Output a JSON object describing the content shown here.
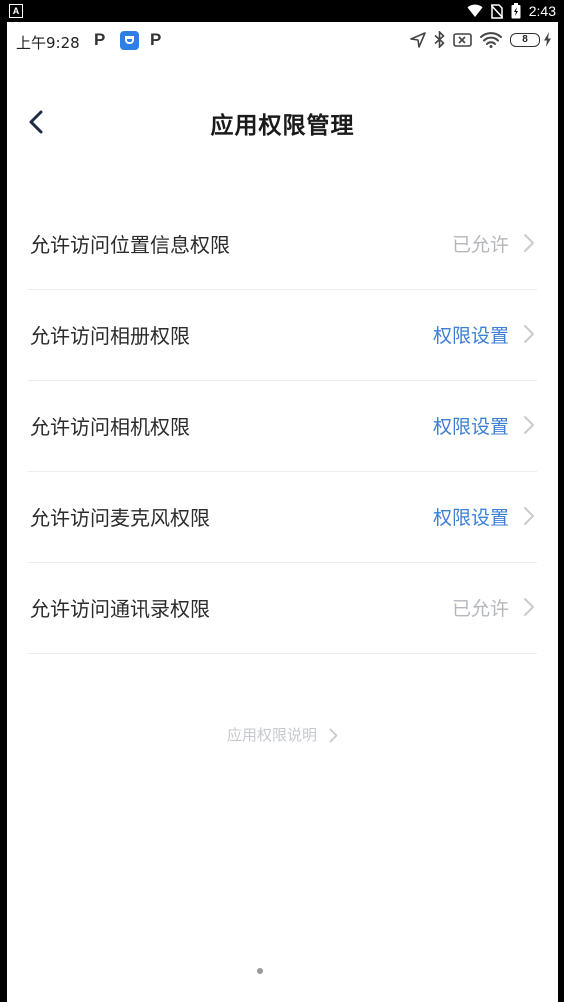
{
  "system_bar": {
    "notification_letter": "A",
    "time": "2:43"
  },
  "status_bar": {
    "time": "上午9:28",
    "p1": "P",
    "p2": "P",
    "battery_level": "8"
  },
  "header": {
    "title": "应用权限管理"
  },
  "permissions": [
    {
      "label": "允许访问位置信息权限",
      "status": "已允许",
      "state": "granted"
    },
    {
      "label": "允许访问相册权限",
      "status": "权限设置",
      "state": "setting"
    },
    {
      "label": "允许访问相机权限",
      "status": "权限设置",
      "state": "setting"
    },
    {
      "label": "允许访问麦克风权限",
      "status": "权限设置",
      "state": "setting"
    },
    {
      "label": "允许访问通讯录权限",
      "status": "已允许",
      "state": "granted"
    }
  ],
  "footer": {
    "explain_link": "应用权限说明"
  },
  "colors": {
    "accent": "#3d7fd6",
    "granted_text": "#b4b7bc",
    "app_icon": "#2f7ee6"
  }
}
